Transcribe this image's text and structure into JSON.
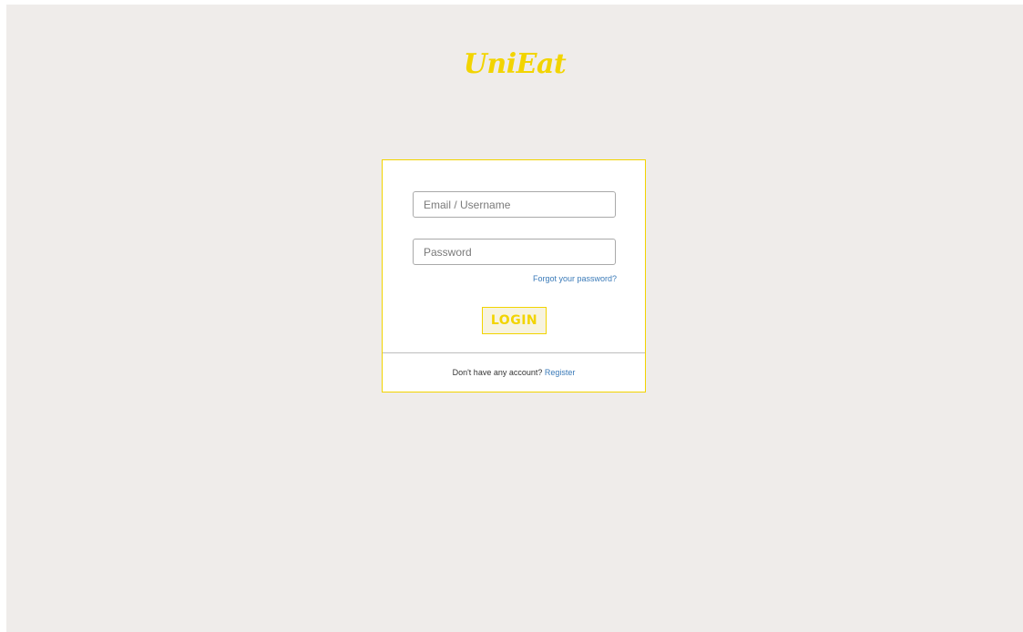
{
  "app": {
    "logo_text": "UniEat",
    "brand_color": "#f2d400"
  },
  "login_form": {
    "email_placeholder": "Email / Username",
    "email_value": "",
    "password_placeholder": "Password",
    "password_value": "",
    "forgot_link": "Forgot your password?",
    "login_label": "LOGIN",
    "no_account_text": "Don't have any account?",
    "register_link": "Register"
  },
  "colors": {
    "page_background": "#efecea",
    "card_background": "#ffffff",
    "link": "#3a7ab8"
  }
}
